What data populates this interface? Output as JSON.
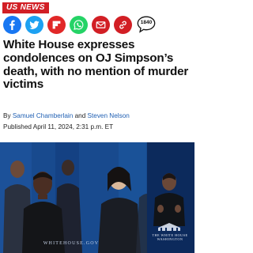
{
  "section": {
    "label": "US NEWS"
  },
  "share": {
    "buttons": [
      {
        "name": "facebook",
        "icon": "facebook-icon",
        "color": "#1877f2"
      },
      {
        "name": "twitter",
        "icon": "twitter-icon",
        "color": "#1da1f2"
      },
      {
        "name": "flipboard",
        "icon": "flipboard-icon",
        "color": "#e12828"
      },
      {
        "name": "whatsapp",
        "icon": "whatsapp-icon",
        "color": "#25d366"
      },
      {
        "name": "email",
        "icon": "email-icon",
        "color": "#d21f25"
      },
      {
        "name": "copy-link",
        "icon": "link-icon",
        "color": "#d21f25"
      }
    ],
    "comments_count": "1840"
  },
  "article": {
    "headline": "White House expresses condolences on OJ Simpson’s death, with no mention of murder victims",
    "byline_prefix": "By",
    "author_1": "Samuel Chamberlain",
    "byline_and": "and",
    "author_2": "Steven Nelson",
    "published": "Published April 11, 2024, 2:31 p.m. ET"
  },
  "video": {
    "watermark": "WHITEHOUSE.GOV",
    "seal_caption": "THE WHITE HOUSE WASHINGTON"
  },
  "colors": {
    "brand_red": "#d21f25",
    "link_blue": "#1f5fb3",
    "video_bg": "#1b4d93"
  }
}
